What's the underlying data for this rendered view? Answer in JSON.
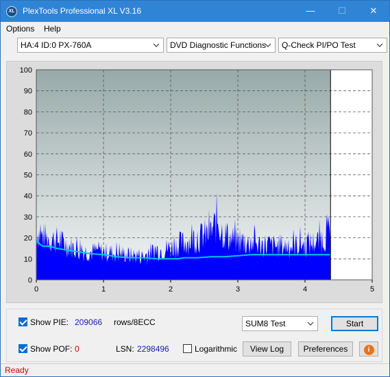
{
  "window": {
    "title": "PlexTools Professional XL V3.16",
    "icon_text": "XL",
    "minimize": "—",
    "maximize": "☐",
    "close": "✕"
  },
  "menu": {
    "items": [
      "Options",
      "Help"
    ]
  },
  "toolbar": {
    "drive": "HA:4 ID:0  PX-760A",
    "function": "DVD Diagnostic Functions",
    "test": "Q-Check PI/PO Test"
  },
  "chart_data": {
    "type": "area",
    "x_ticks": [
      "0",
      "1",
      "2",
      "3",
      "4",
      "5"
    ],
    "y_ticks": [
      "0",
      "10",
      "20",
      "30",
      "40",
      "50",
      "60",
      "70",
      "80",
      "90",
      "100"
    ],
    "xlim": [
      0,
      5
    ],
    "ylim": [
      0,
      100
    ],
    "grid": true,
    "data_end_x": 4.38,
    "colors": {
      "pie": "#0000ff",
      "avg": "#00c8e6",
      "bg_top": "#97aaa9",
      "bg_bottom": "#f4f6f6"
    },
    "series": [
      {
        "values_x": [
          0,
          0.1,
          0.2,
          0.3,
          0.4,
          0.5,
          0.6,
          0.7,
          0.8,
          0.9,
          1.0,
          1.1,
          1.2,
          1.3,
          1.4,
          1.5,
          1.6,
          1.7,
          1.8,
          1.9,
          2.0,
          2.1,
          2.2,
          2.3,
          2.4,
          2.5,
          2.6,
          2.65,
          2.7,
          2.75,
          2.8,
          2.9,
          3.0,
          3.1,
          3.2,
          3.3,
          3.4,
          3.5,
          3.6,
          3.7,
          3.8,
          3.9,
          4.0,
          4.1,
          4.2,
          4.3,
          4.38
        ],
        "values_y": [
          32,
          28,
          27,
          26,
          24,
          22,
          20,
          19,
          18,
          19,
          18,
          18,
          17,
          17,
          16,
          16,
          15,
          18,
          19,
          20,
          21,
          23,
          24,
          26,
          27,
          29,
          31,
          35,
          38,
          33,
          30,
          27,
          25,
          24,
          24,
          23,
          23,
          22,
          22,
          22,
          22,
          23,
          23,
          24,
          25,
          28,
          33
        ]
      },
      {
        "values_x": [
          0,
          0.05,
          0.1,
          0.2,
          0.3,
          0.4,
          0.5,
          0.6,
          0.8,
          1.0,
          1.2,
          1.4,
          1.6,
          1.8,
          2.0,
          2.1,
          2.2,
          2.4,
          2.6,
          2.8,
          3.0,
          3.2,
          3.4,
          3.6,
          3.8,
          4.0,
          4.2,
          4.38
        ],
        "values_y": [
          19,
          17,
          16,
          16,
          15,
          14.5,
          14,
          13.5,
          12.5,
          12,
          11,
          10.5,
          10.5,
          10,
          10,
          10,
          10.5,
          10.5,
          11,
          11,
          11.5,
          12,
          12,
          12,
          12,
          12,
          12,
          12
        ]
      }
    ]
  },
  "controls": {
    "show_pie_label": "Show PIE:",
    "pie_value": "209066",
    "pie_unit": "rows/8ECC",
    "show_pof_label": "Show POF:",
    "pof_value": "0",
    "lsn_label": "LSN:",
    "lsn_value": "2298496",
    "log_label": "Logarithmic",
    "test_select": "SUM8 Test",
    "start": "Start",
    "view_log": "View Log",
    "preferences": "Preferences",
    "info_icon": "i"
  },
  "status": {
    "text": "Ready"
  }
}
